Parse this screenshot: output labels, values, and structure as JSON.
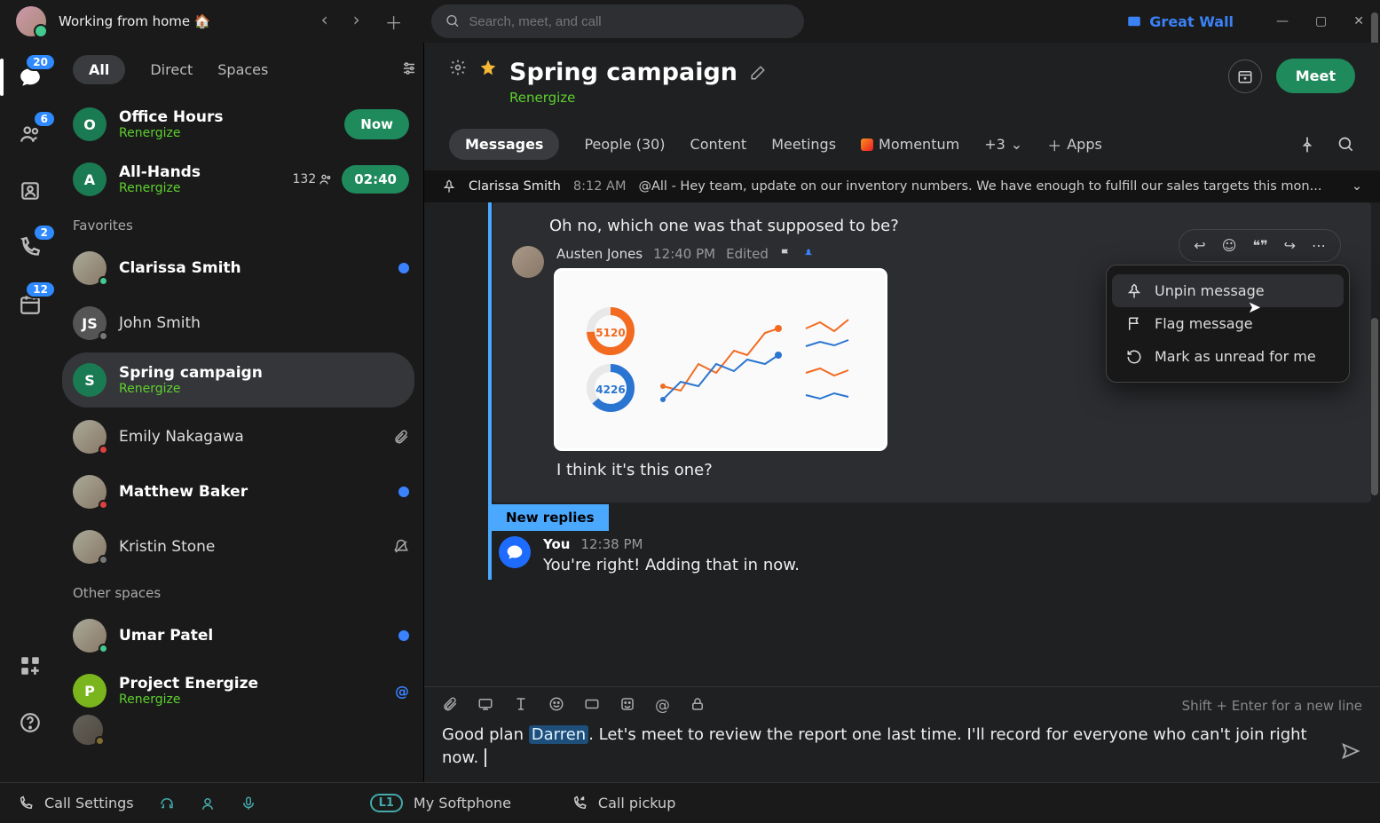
{
  "status": "Working from home 🏠",
  "search_placeholder": "Search, meet, and call",
  "brand": "Great Wall",
  "rail": {
    "chat_badge": "20",
    "contacts_badge": "6",
    "call_badge": "2",
    "cal_badge": "12"
  },
  "filters": {
    "all": "All",
    "direct": "Direct",
    "spaces": "Spaces"
  },
  "sections": {
    "favorites": "Favorites",
    "other": "Other spaces"
  },
  "conversations": {
    "office_hours": {
      "title": "Office Hours",
      "sub": "Renergize",
      "now": "Now",
      "initial": "O"
    },
    "all_hands": {
      "title": "All-Hands",
      "sub": "Renergize",
      "count": "132",
      "time": "02:40",
      "initial": "A"
    },
    "clarissa": {
      "title": "Clarissa Smith"
    },
    "john": {
      "title": "John Smith",
      "initials": "JS"
    },
    "spring": {
      "title": "Spring campaign",
      "sub": "Renergize",
      "initial": "S"
    },
    "emily": {
      "title": "Emily Nakagawa"
    },
    "matthew": {
      "title": "Matthew Baker"
    },
    "kristin": {
      "title": "Kristin Stone"
    },
    "umar": {
      "title": "Umar Patel"
    },
    "project": {
      "title": "Project Energize",
      "sub": "Renergize",
      "initial": "P"
    }
  },
  "chat_header": {
    "title": "Spring campaign",
    "sub": "Renergize",
    "meet": "Meet"
  },
  "tabs": {
    "messages": "Messages",
    "people": "People (30)",
    "content": "Content",
    "meetings": "Meetings",
    "momentum": "Momentum",
    "plus3": "+3",
    "apps": "Apps"
  },
  "pin": {
    "author": "Clarissa Smith",
    "time": "8:12 AM",
    "text": "@All - Hey team, update on our inventory numbers. We have enough to fulfill our sales targets this mon..."
  },
  "msg_top": {
    "text": "Oh no, which one was that supposed to be?"
  },
  "msg_austen": {
    "author": "Austen Jones",
    "time": "12:40 PM",
    "edited": "Edited",
    "text": "I think it's this one?",
    "chart_data": {
      "left": [
        5120,
        4226
      ],
      "line_x": [
        1,
        2,
        3,
        4,
        5,
        6,
        7,
        8
      ],
      "series_a": [
        30,
        25,
        45,
        35,
        55,
        50,
        70,
        75
      ],
      "series_b": [
        20,
        35,
        30,
        50,
        45,
        55,
        50,
        58
      ]
    }
  },
  "new_replies": "New replies",
  "msg_you": {
    "author": "You",
    "time": "12:38 PM",
    "text": "You're right! Adding that in now."
  },
  "ctx": {
    "unpin": "Unpin message",
    "flag": "Flag message",
    "unread": "Mark as unread for me"
  },
  "composer": {
    "hint": "Shift + Enter for a new line",
    "pre": "Good plan ",
    "mention": "Darren",
    "post": ". Let's meet to review the report one last time. I'll record for everyone who can't join right now."
  },
  "footer": {
    "call_settings": "Call Settings",
    "softphone": "My Softphone",
    "l1": "L1",
    "pickup": "Call pickup"
  }
}
